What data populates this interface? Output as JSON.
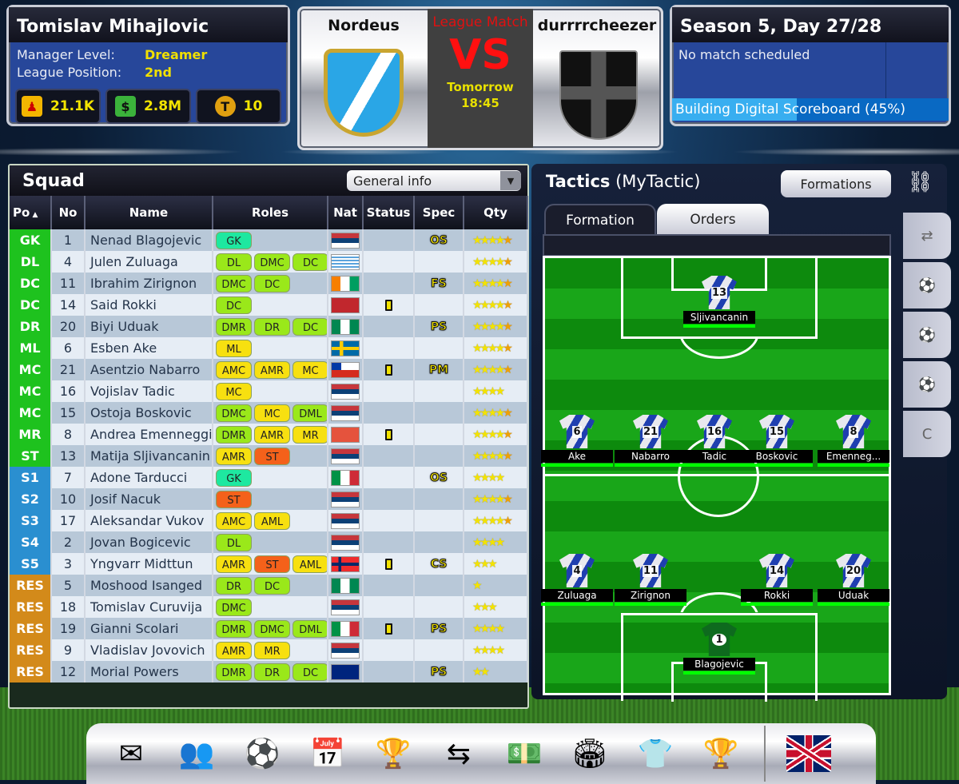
{
  "manager": {
    "name": "Tomislav Mihajlovic",
    "level_label": "Manager Level:",
    "level": "Dreamer",
    "pos_label": "League Position:",
    "position": "2nd",
    "fans": "21.1K",
    "money": "2.8M",
    "tokens": "10"
  },
  "match": {
    "home": "Nordeus",
    "away": "durrrrcheezer",
    "type": "League Match",
    "vs": "VS",
    "day": "Tomorrow",
    "time": "18:45"
  },
  "season": {
    "title": "Season 5, Day 27/28",
    "status": "No match scheduled",
    "progress_label": "Building Digital Scoreboard (45%)",
    "progress": 0.45
  },
  "squad": {
    "title": "Squad",
    "view": "General info",
    "columns": [
      "Po",
      "No",
      "Name",
      "Roles",
      "Nat",
      "Status",
      "Spec",
      "Qty"
    ],
    "rows": [
      {
        "po": "GK",
        "no": "1",
        "name": "Nenad Blagojevic",
        "roles": [
          "GK"
        ],
        "nat": "serbia",
        "card": false,
        "spec": "OS",
        "qty": 4.5
      },
      {
        "po": "DL",
        "no": "4",
        "name": "Julen Zuluaga",
        "roles": [
          "DL",
          "DMC",
          "DC"
        ],
        "nat": "uruguay",
        "card": false,
        "spec": "",
        "qty": 4.5
      },
      {
        "po": "DC",
        "no": "11",
        "name": "Ibrahim Zirignon",
        "roles": [
          "DMC",
          "DC"
        ],
        "nat": "ivory-coast",
        "card": false,
        "spec": "FS",
        "qty": 4.5
      },
      {
        "po": "DC",
        "no": "14",
        "name": "Said Rokki",
        "roles": [
          "DC"
        ],
        "nat": "morocco",
        "card": true,
        "spec": "",
        "qty": 4.5
      },
      {
        "po": "DR",
        "no": "20",
        "name": "Biyi Uduak",
        "roles": [
          "DMR",
          "DR",
          "DC"
        ],
        "nat": "nigeria",
        "card": false,
        "spec": "PS",
        "qty": 4.5
      },
      {
        "po": "ML",
        "no": "6",
        "name": "Esben Ake",
        "roles": [
          "ML"
        ],
        "nat": "sweden",
        "card": false,
        "spec": "",
        "qty": 4.5
      },
      {
        "po": "MC",
        "no": "21",
        "name": "Asentzio Nabarro",
        "roles": [
          "AMC",
          "AMR",
          "MC"
        ],
        "nat": "chile",
        "card": true,
        "spec": "PM",
        "qty": 4.5
      },
      {
        "po": "MC",
        "no": "16",
        "name": "Vojislav Tadic",
        "roles": [
          "MC"
        ],
        "nat": "serbia",
        "card": false,
        "spec": "",
        "qty": 4
      },
      {
        "po": "MC",
        "no": "15",
        "name": "Ostoja Boskovic",
        "roles": [
          "DMC",
          "MC",
          "DML"
        ],
        "nat": "serbia",
        "card": false,
        "spec": "",
        "qty": 4.5
      },
      {
        "po": "MR",
        "no": "8",
        "name": "Andrea Emenneggi",
        "roles": [
          "DMR",
          "AMR",
          "MR"
        ],
        "nat": "switzerland",
        "card": true,
        "spec": "",
        "qty": 4.5
      },
      {
        "po": "ST",
        "no": "13",
        "name": "Matija Sljivancanin",
        "roles": [
          "AMR",
          "ST"
        ],
        "nat": "serbia",
        "card": false,
        "spec": "",
        "qty": 4.5
      },
      {
        "po": "S1",
        "no": "7",
        "name": "Adone Tarducci",
        "roles": [
          "GK"
        ],
        "nat": "italy",
        "card": false,
        "spec": "OS",
        "qty": 4
      },
      {
        "po": "S2",
        "no": "10",
        "name": "Josif Nacuk",
        "roles": [
          "ST"
        ],
        "nat": "serbia",
        "card": false,
        "spec": "",
        "qty": 4.5
      },
      {
        "po": "S3",
        "no": "17",
        "name": "Aleksandar Vukov",
        "roles": [
          "AMC",
          "AML"
        ],
        "nat": "serbia",
        "card": false,
        "spec": "",
        "qty": 4.5
      },
      {
        "po": "S4",
        "no": "2",
        "name": "Jovan Bogicevic",
        "roles": [
          "DL"
        ],
        "nat": "serbia",
        "card": false,
        "spec": "",
        "qty": 4
      },
      {
        "po": "S5",
        "no": "3",
        "name": "Yngvarr Midttun",
        "roles": [
          "AMR",
          "ST",
          "AML"
        ],
        "nat": "norway",
        "card": true,
        "spec": "CS",
        "qty": 3
      },
      {
        "po": "RES",
        "no": "5",
        "name": "Moshood Isanged",
        "roles": [
          "DR",
          "DC"
        ],
        "nat": "nigeria",
        "card": false,
        "spec": "",
        "qty": 1
      },
      {
        "po": "RES",
        "no": "18",
        "name": "Tomislav Curuvija",
        "roles": [
          "DMC"
        ],
        "nat": "serbia",
        "card": false,
        "spec": "",
        "qty": 3
      },
      {
        "po": "RES",
        "no": "19",
        "name": "Gianni Scolari",
        "roles": [
          "DMR",
          "DMC",
          "DML"
        ],
        "nat": "italy",
        "card": true,
        "spec": "PS",
        "qty": 4
      },
      {
        "po": "RES",
        "no": "9",
        "name": "Vladislav Jovovich",
        "roles": [
          "AMR",
          "MR"
        ],
        "nat": "serbia",
        "card": false,
        "spec": "",
        "qty": 4
      },
      {
        "po": "RES",
        "no": "12",
        "name": "Morial Powers",
        "roles": [
          "DMR",
          "DR",
          "DC"
        ],
        "nat": "australia",
        "card": false,
        "spec": "PS",
        "qty": 2
      }
    ]
  },
  "tactics": {
    "title": "Tactics",
    "name": "(MyTactic)",
    "formations_btn": "Formations",
    "tabs": [
      "Formation",
      "Orders"
    ],
    "side_tabs": [
      "swap-players",
      "set-piece-corner",
      "free-kick",
      "penalty",
      "captain"
    ],
    "captain_label": "C",
    "players": [
      {
        "no": "13",
        "name": "Sljivancanin",
        "line": "st"
      },
      {
        "no": "6",
        "name": "Ake",
        "line": "mid"
      },
      {
        "no": "21",
        "name": "Nabarro",
        "line": "mid"
      },
      {
        "no": "16",
        "name": "Tadic",
        "line": "mid"
      },
      {
        "no": "15",
        "name": "Boskovic",
        "line": "mid"
      },
      {
        "no": "8",
        "name": "Emenneg...",
        "line": "mid"
      },
      {
        "no": "4",
        "name": "Zuluaga",
        "line": "def"
      },
      {
        "no": "11",
        "name": "Zirignon",
        "line": "def"
      },
      {
        "no": "14",
        "name": "Rokki",
        "line": "def"
      },
      {
        "no": "20",
        "name": "Uduak",
        "line": "def"
      },
      {
        "no": "1",
        "name": "Blagojevic",
        "line": "gk"
      }
    ]
  },
  "dock": [
    "mail",
    "squad",
    "training",
    "calendar",
    "league",
    "transfers",
    "finances",
    "stadium",
    "club",
    "trophies",
    "language-uk"
  ],
  "colors": {
    "first_team": "#1ec21e",
    "subs": "#2a8fd0",
    "reserves": "#d38a1a",
    "role_def": "#9ae81a",
    "role_mid": "#f7e010",
    "role_att": "#f4611a",
    "role_gk": "#1ee8a0"
  }
}
